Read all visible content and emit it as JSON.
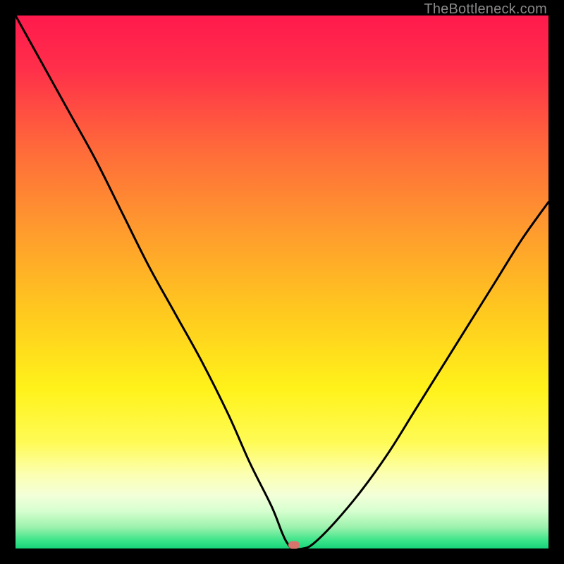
{
  "watermark": "TheBottleneck.com",
  "gradient": {
    "stops": [
      {
        "offset": 0.0,
        "color": "#ff1a4d"
      },
      {
        "offset": 0.1,
        "color": "#ff2f4a"
      },
      {
        "offset": 0.25,
        "color": "#ff6a3a"
      },
      {
        "offset": 0.4,
        "color": "#ff9a2e"
      },
      {
        "offset": 0.55,
        "color": "#ffc71f"
      },
      {
        "offset": 0.7,
        "color": "#fff21a"
      },
      {
        "offset": 0.8,
        "color": "#fffb55"
      },
      {
        "offset": 0.86,
        "color": "#fcffb0"
      },
      {
        "offset": 0.9,
        "color": "#f3ffd8"
      },
      {
        "offset": 0.93,
        "color": "#d6ffcf"
      },
      {
        "offset": 0.96,
        "color": "#9cf2ad"
      },
      {
        "offset": 0.985,
        "color": "#3be489"
      },
      {
        "offset": 1.0,
        "color": "#17d37a"
      }
    ]
  },
  "chart_data": {
    "type": "line",
    "title": "",
    "xlabel": "",
    "ylabel": "",
    "xlim": [
      0,
      100
    ],
    "ylim": [
      0,
      100
    ],
    "series": [
      {
        "name": "curve",
        "x": [
          0,
          5,
          10,
          15,
          20,
          25,
          30,
          35,
          40,
          44,
          48,
          50,
          51,
          52,
          54,
          56,
          60,
          65,
          70,
          75,
          80,
          85,
          90,
          95,
          100
        ],
        "y": [
          100,
          91,
          82,
          73,
          63,
          53,
          44,
          35,
          25,
          16,
          8,
          3,
          1,
          0,
          0,
          1,
          5,
          11,
          18,
          26,
          34,
          42,
          50,
          58,
          65
        ]
      }
    ],
    "marker": {
      "x": 52.3,
      "y": 0.6
    }
  }
}
